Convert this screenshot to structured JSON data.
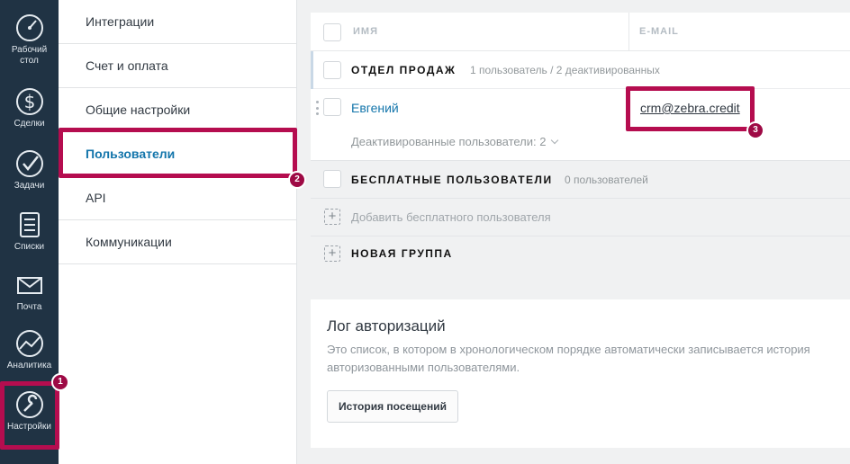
{
  "sidebar": {
    "items": [
      {
        "label": "Рабочий\nстол",
        "icon": "dashboard-icon"
      },
      {
        "label": "Сделки",
        "icon": "dollar-icon"
      },
      {
        "label": "Задачи",
        "icon": "checkmark-icon"
      },
      {
        "label": "Списки",
        "icon": "list-icon"
      },
      {
        "label": "Почта",
        "icon": "mail-icon"
      },
      {
        "label": "Аналитика",
        "icon": "analytics-icon"
      },
      {
        "label": "Настройки",
        "icon": "wrench-icon"
      }
    ]
  },
  "settings_menu": {
    "items": [
      {
        "label": "Интеграции"
      },
      {
        "label": "Счет и оплата"
      },
      {
        "label": "Общие настройки"
      },
      {
        "label": "Пользователи",
        "active": true
      },
      {
        "label": "API"
      },
      {
        "label": "Коммуникации"
      }
    ]
  },
  "users_table": {
    "columns": [
      "ИМЯ",
      "E-MAIL"
    ],
    "groups": [
      {
        "title": "ОТДЕЛ ПРОДАЖ",
        "count": "1 пользователь / 2 деактивированных",
        "users": [
          {
            "name": "Евгений",
            "email": "crm@zebra.credit"
          }
        ],
        "deactivated_label": "Деактивированные пользователи: 2"
      },
      {
        "title": "БЕСПЛАТНЫЕ ПОЛЬЗОВАТЕЛИ",
        "count": "0 пользователей",
        "add_label": "Добавить бесплатного пользователя"
      }
    ],
    "new_group_label": "НОВАЯ ГРУППА"
  },
  "auth_log": {
    "title": "Лог авторизаций",
    "description_line1": "Это список, в котором в хронологическом порядке автоматически записывается история",
    "description_line2": "авторизованными пользователями.",
    "button_label": "История посещений"
  },
  "annotations": [
    "1",
    "2",
    "3"
  ],
  "colors": {
    "sidebar_bg": "#203344",
    "accent_link": "#1375ab",
    "highlight": "#b50d4f"
  }
}
